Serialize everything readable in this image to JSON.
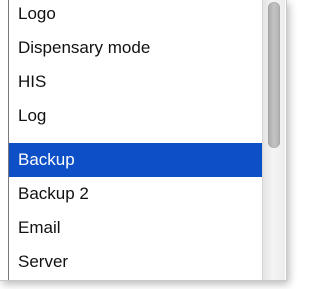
{
  "list": {
    "items": [
      {
        "label": "Logo",
        "selected": false
      },
      {
        "label": "Dispensary mode",
        "selected": false
      },
      {
        "label": "HIS",
        "selected": false
      },
      {
        "label": "Log",
        "selected": false
      },
      {
        "label": "Backup",
        "selected": true
      },
      {
        "label": "Backup 2",
        "selected": false
      },
      {
        "label": "Email",
        "selected": false
      },
      {
        "label": "Server",
        "selected": false
      }
    ]
  },
  "colors": {
    "selection": "#0c4fc7",
    "text": "#111111",
    "selected_text": "#ffffff"
  }
}
